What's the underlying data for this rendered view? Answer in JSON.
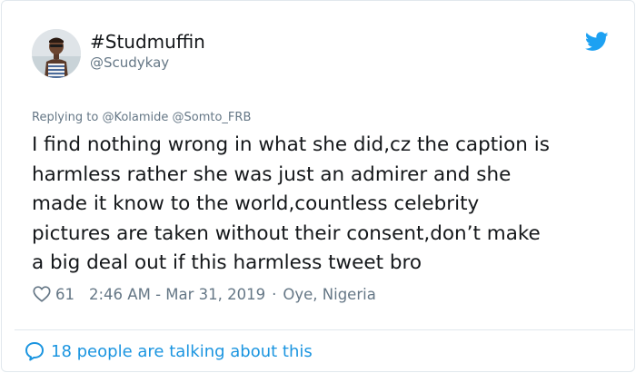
{
  "user": {
    "display_name": "#Studmuffin",
    "handle": "@Scudykay"
  },
  "reply": {
    "prefix": "Replying to",
    "mentions": [
      "@Kolamide",
      "@Somto_FRB"
    ]
  },
  "tweet": {
    "text": "I find nothing wrong in what she did,cz the caption is\nharmless rather she was just an admirer and she\nmade it know to the world,countless celebrity\npictures are taken without their consent,don’t make\na big deal out if this harmless tweet bro"
  },
  "meta": {
    "like_count": "61",
    "timestamp": "2:46 AM - Mar 31, 2019",
    "separator": "·",
    "location": "Oye, Nigeria"
  },
  "footer": {
    "talking_text": "18 people are talking about this"
  },
  "icons": {
    "logo": "twitter-bird-icon",
    "like": "heart-icon",
    "talking": "speech-bubble-icon"
  },
  "colors": {
    "accent": "#1da1f2",
    "link": "#1b95e0",
    "secondary_text": "#657786",
    "primary_text": "#14171a",
    "border": "#e1e8ed"
  }
}
